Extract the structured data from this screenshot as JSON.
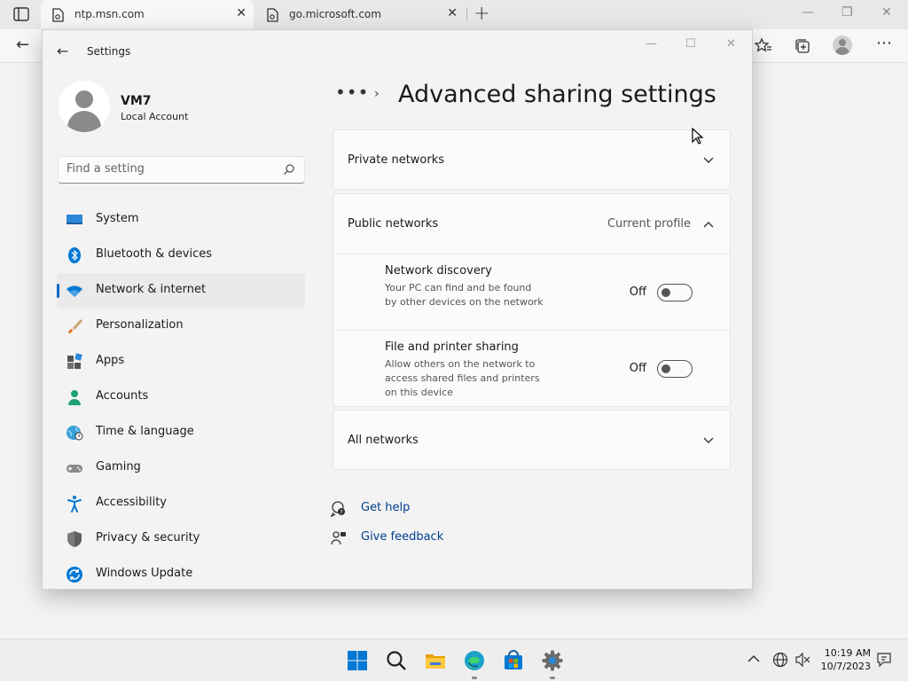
{
  "browser": {
    "tabs": [
      {
        "title": "ntp.msn.com",
        "active": true
      },
      {
        "title": "go.microsoft.com",
        "active": false
      }
    ],
    "new_tab_symbol": "+",
    "close_symbol": "✕"
  },
  "settings_window": {
    "title": "Settings",
    "user": {
      "name": "VM7",
      "account_type": "Local Account"
    },
    "search": {
      "placeholder": "Find a setting"
    },
    "nav": [
      {
        "label": "System",
        "icon": "monitor-icon",
        "selected": false
      },
      {
        "label": "Bluetooth & devices",
        "icon": "bluetooth-icon",
        "selected": false
      },
      {
        "label": "Network & internet",
        "icon": "wifi-icon",
        "selected": true
      },
      {
        "label": "Personalization",
        "icon": "brush-icon",
        "selected": false
      },
      {
        "label": "Apps",
        "icon": "apps-icon",
        "selected": false
      },
      {
        "label": "Accounts",
        "icon": "person-icon",
        "selected": false
      },
      {
        "label": "Time & language",
        "icon": "globe-clock-icon",
        "selected": false
      },
      {
        "label": "Gaming",
        "icon": "gamepad-icon",
        "selected": false
      },
      {
        "label": "Accessibility",
        "icon": "accessibility-icon",
        "selected": false
      },
      {
        "label": "Privacy & security",
        "icon": "shield-icon",
        "selected": false
      },
      {
        "label": "Windows Update",
        "icon": "update-icon",
        "selected": false
      }
    ],
    "breadcrumb_more": "•••",
    "page_title": "Advanced sharing settings",
    "sections": {
      "private": {
        "label": "Private networks",
        "expanded": false
      },
      "public": {
        "label": "Public networks",
        "tag": "Current profile",
        "expanded": true,
        "rows": [
          {
            "title": "Network discovery",
            "description": "Your PC can find and be found by other devices on the network",
            "state": "Off"
          },
          {
            "title": "File and printer sharing",
            "description": "Allow others on the network to access shared files and printers on this device",
            "state": "Off"
          }
        ]
      },
      "all": {
        "label": "All networks",
        "expanded": false
      }
    },
    "links": {
      "help": "Get help",
      "feedback": "Give feedback"
    }
  },
  "taskbar": {
    "time": "10:19 AM",
    "date": "10/7/2023"
  },
  "colors": {
    "accent": "#0067c0",
    "link": "#003e92"
  }
}
